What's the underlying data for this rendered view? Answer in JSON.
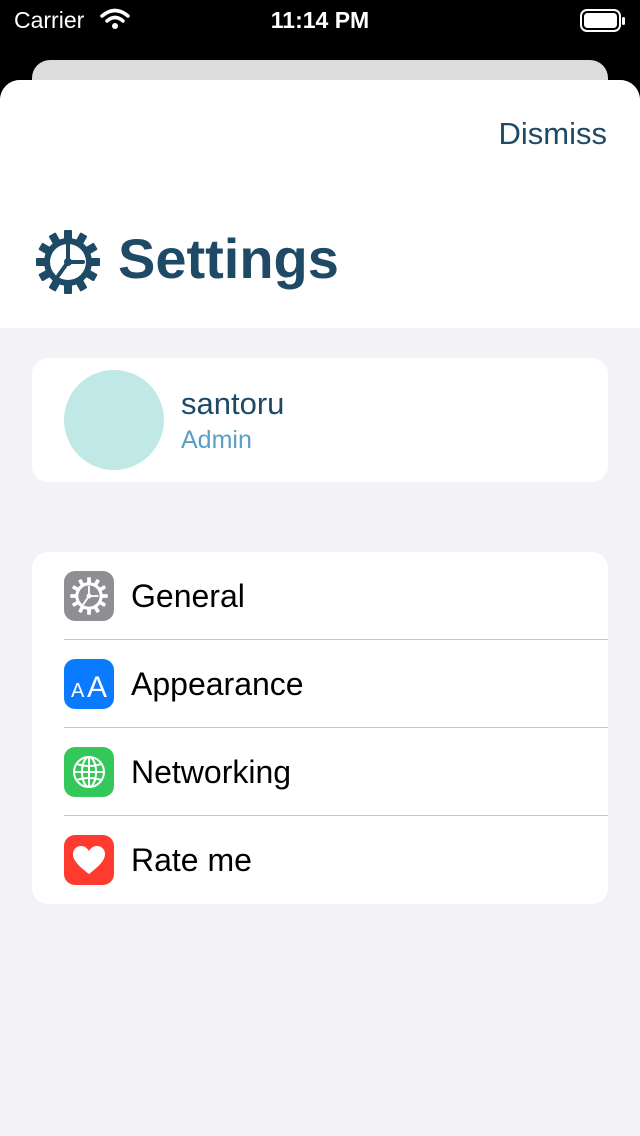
{
  "status_bar": {
    "carrier": "Carrier",
    "time": "11:14 PM"
  },
  "header": {
    "dismiss_label": "Dismiss",
    "title": "Settings"
  },
  "profile": {
    "username": "santoru",
    "role": "Admin"
  },
  "menu": {
    "items": [
      {
        "label": "General",
        "icon": "gear-icon",
        "color": "#8e8e93"
      },
      {
        "label": "Appearance",
        "icon": "text-size-icon",
        "color": "#0a7aff"
      },
      {
        "label": "Networking",
        "icon": "globe-icon",
        "color": "#34c759"
      },
      {
        "label": "Rate me",
        "icon": "heart-icon",
        "color": "#ff3b30"
      }
    ]
  },
  "colors": {
    "accent": "#1e4a66",
    "secondary": "#5b9fc7",
    "background": "#f2f2f7",
    "avatar": "#c0e8e6"
  }
}
